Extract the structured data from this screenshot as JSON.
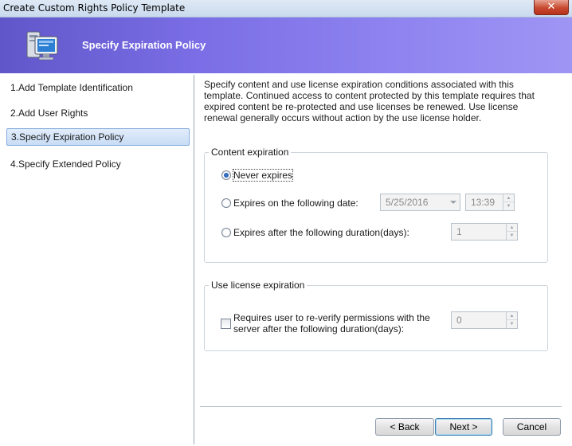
{
  "window": {
    "title": "Create Custom Rights Policy Template",
    "close_glyph": "✕"
  },
  "banner": {
    "heading": "Specify Expiration Policy",
    "icon": "computer-policy-icon"
  },
  "nav": {
    "items": [
      {
        "label": "1.Add Template Identification"
      },
      {
        "label": "2.Add User Rights"
      },
      {
        "label": "3.Specify Expiration Policy"
      },
      {
        "label": "4.Specify Extended Policy"
      }
    ],
    "selected_index": 2
  },
  "content": {
    "description": "Specify content and use license expiration conditions associated with this template. Continued access to content protected by this template requires that expired content be re-protected and use licenses be renewed. Use license renewal generally occurs without action by the use license holder.",
    "content_expiration": {
      "title": "Content expiration",
      "never_label": "Never expires",
      "on_date_label": "Expires on the following date:",
      "date_value": "5/25/2016",
      "time_value": "13:39",
      "after_duration_label": "Expires after the following duration(days):",
      "duration_value": "1",
      "selected": "never"
    },
    "use_license_expiration": {
      "title": "Use license expiration",
      "reverify_label_line1": "Requires user to re-verify permissions with the",
      "reverify_label_line2": "server after the following duration(days):",
      "reverify_checked": false,
      "reverify_value": "0"
    }
  },
  "buttons": {
    "back": "< Back",
    "next": "Next >",
    "cancel": "Cancel"
  },
  "colors": {
    "banner_start": "#6156c9",
    "banner_end": "#9f95f4",
    "selection": "#c8dcf5"
  }
}
